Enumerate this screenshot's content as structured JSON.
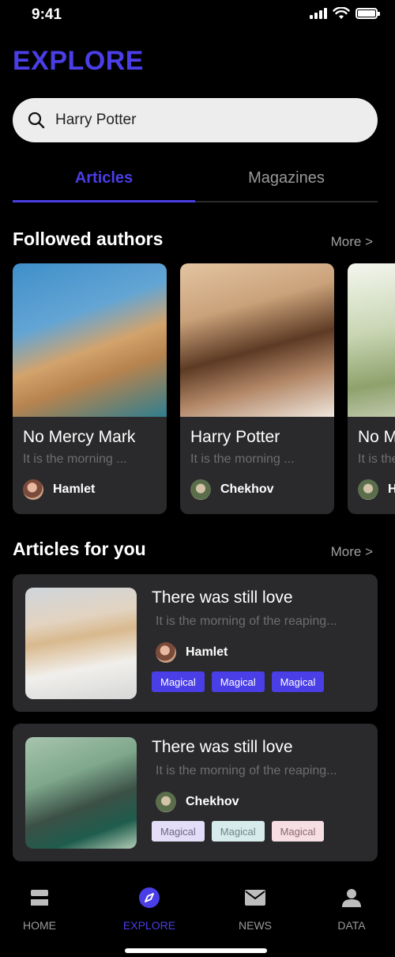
{
  "status_bar": {
    "time": "9:41"
  },
  "page": {
    "title": "EXPLORE"
  },
  "search": {
    "value": "Harry Potter",
    "placeholder": ""
  },
  "tabs": [
    {
      "label": "Articles",
      "active": true
    },
    {
      "label": "Magazines",
      "active": false
    }
  ],
  "followed_authors": {
    "title": "Followed authors",
    "more_label": "More >",
    "cards": [
      {
        "title": "No Mercy Mark",
        "subtitle": "It is the morning ...",
        "author": "Hamlet"
      },
      {
        "title": "Harry Potter",
        "subtitle": "It is the morning ...",
        "author": "Chekhov"
      },
      {
        "title": "No Mercy Mark",
        "subtitle": "It is the morning ...",
        "author": "Hamlet"
      }
    ]
  },
  "articles_for_you": {
    "title": "Articles for you",
    "more_label": "More >",
    "items": [
      {
        "title": "There was still love",
        "subtitle": "It is the morning of the reaping...",
        "author": "Hamlet",
        "tags": [
          "Magical",
          "Magical",
          "Magical"
        ]
      },
      {
        "title": "There was still love",
        "subtitle": "It is the morning of the reaping...",
        "author": "Chekhov",
        "tags": [
          "Magical",
          "Magical",
          "Magical"
        ]
      }
    ]
  },
  "bottom_nav": [
    {
      "label": "HOME",
      "icon": "home-stack-icon",
      "active": false
    },
    {
      "label": "EXPLORE",
      "icon": "compass-icon",
      "active": true
    },
    {
      "label": "NEWS",
      "icon": "mail-icon",
      "active": false
    },
    {
      "label": "DATA",
      "icon": "person-icon",
      "active": false
    }
  ],
  "colors": {
    "accent": "#4a3ee6",
    "background": "#000000",
    "card": "#2a2a2c"
  }
}
